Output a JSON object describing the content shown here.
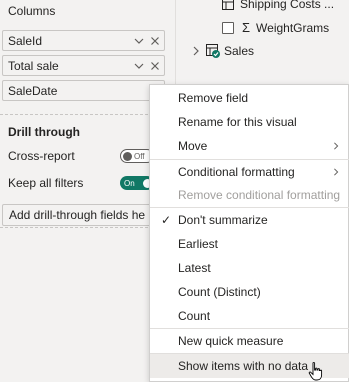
{
  "left": {
    "columns_label": "Columns",
    "fields": [
      {
        "label": "SaleId",
        "removable": true
      },
      {
        "label": "Total sale",
        "removable": true
      },
      {
        "label": "SaleDate",
        "removable": false
      }
    ],
    "drill_through": {
      "title": "Drill through",
      "cross_report": {
        "label": "Cross-report",
        "state": "Off"
      },
      "keep_all_filters": {
        "label": "Keep all filters",
        "state": "On"
      },
      "add_fields": "Add drill-through fields he"
    }
  },
  "right": {
    "tree": [
      {
        "label": "Shipping Costs ...",
        "kind": "field-table"
      },
      {
        "label": "WeightGrams",
        "kind": "measure"
      },
      {
        "label": "Sales",
        "kind": "table"
      }
    ]
  },
  "menu": {
    "items": [
      {
        "label": "Remove field"
      },
      {
        "label": "Rename for this visual"
      },
      {
        "label": "Move",
        "submenu": true
      },
      {
        "label": "Conditional formatting",
        "submenu": true
      },
      {
        "label": "Remove conditional formatting",
        "disabled": true
      },
      {
        "label": "Don't summarize",
        "checked": true
      },
      {
        "label": "Earliest"
      },
      {
        "label": "Latest"
      },
      {
        "label": "Count (Distinct)"
      },
      {
        "label": "Count"
      },
      {
        "label": "New quick measure"
      },
      {
        "label": "Show items with no data",
        "hovered": true
      }
    ]
  },
  "colors": {
    "accent_green": "#117865",
    "menu_hover": "#edebe9",
    "disabled_text": "#a19f9d"
  }
}
